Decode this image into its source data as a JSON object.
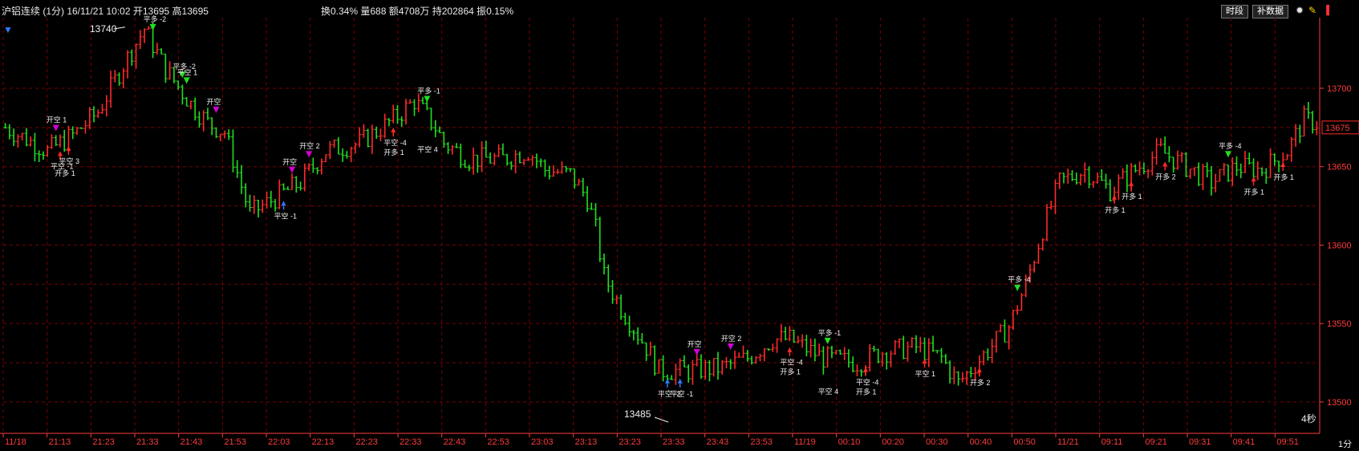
{
  "header": {
    "title": "沪铝连续 (1分) 16/11/21 10:02 开13695  高13695",
    "stats": "换0.34% 量688 额4708万 持202864 振0.15%",
    "timeshare_label": "时段",
    "fill_data_label": "补数据",
    "icons": [
      "settings-icon",
      "paint-icon",
      "sidebar-icon"
    ]
  },
  "footer": {
    "speed": "4秒",
    "period": "1分"
  },
  "colors": {
    "up": "#ff2a2a",
    "down": "#20e020",
    "grid": "#7a0000",
    "axis": "#ff3b3b",
    "current_price_box": "#ff2a2a"
  },
  "chart_data": {
    "type": "bar",
    "title": "",
    "y_range": [
      13480,
      13745
    ],
    "y_ticks": [
      13500,
      13550,
      13600,
      13650,
      13700
    ],
    "x_ticks": [
      "11/18",
      "21:13",
      "21:23",
      "21:33",
      "21:43",
      "21:53",
      "22:03",
      "22:13",
      "22:23",
      "22:33",
      "22:43",
      "22:53",
      "23:03",
      "23:13",
      "23:23",
      "23:33",
      "23:43",
      "23:53",
      "11/19",
      "00:10",
      "00:20",
      "00:30",
      "00:40",
      "00:50",
      "11/21",
      "09:11",
      "09:21",
      "09:31",
      "09:41",
      "09:51"
    ],
    "current_price": 13675,
    "high_label": {
      "price": 13740,
      "text": "13740"
    },
    "low_label": {
      "price": 13485,
      "text": "13485"
    },
    "close_path": [
      [
        0,
        13675
      ],
      [
        10,
        13660
      ],
      [
        16,
        13670
      ],
      [
        22,
        13685
      ],
      [
        28,
        13715
      ],
      [
        33,
        13738
      ],
      [
        38,
        13712
      ],
      [
        44,
        13690
      ],
      [
        48,
        13678
      ],
      [
        52,
        13672
      ],
      [
        54,
        13655
      ],
      [
        58,
        13620
      ],
      [
        64,
        13630
      ],
      [
        70,
        13640
      ],
      [
        76,
        13660
      ],
      [
        84,
        13665
      ],
      [
        92,
        13680
      ],
      [
        97,
        13692
      ],
      [
        102,
        13675
      ],
      [
        104,
        13665
      ],
      [
        110,
        13655
      ],
      [
        118,
        13655
      ],
      [
        124,
        13660
      ],
      [
        128,
        13648
      ],
      [
        134,
        13645
      ],
      [
        138,
        13630
      ],
      [
        140,
        13610
      ],
      [
        142,
        13580
      ],
      [
        146,
        13560
      ],
      [
        152,
        13535
      ],
      [
        155,
        13520
      ],
      [
        162,
        13520
      ],
      [
        170,
        13522
      ],
      [
        176,
        13528
      ],
      [
        182,
        13540
      ],
      [
        186,
        13540
      ],
      [
        194,
        13528
      ],
      [
        202,
        13525
      ],
      [
        208,
        13532
      ],
      [
        216,
        13535
      ],
      [
        222,
        13528
      ],
      [
        226,
        13512
      ],
      [
        232,
        13530
      ],
      [
        238,
        13548
      ],
      [
        242,
        13575
      ],
      [
        246,
        13610
      ],
      [
        250,
        13640
      ],
      [
        256,
        13648
      ],
      [
        262,
        13635
      ],
      [
        268,
        13648
      ],
      [
        274,
        13660
      ],
      [
        280,
        13650
      ],
      [
        286,
        13640
      ],
      [
        292,
        13650
      ],
      [
        298,
        13648
      ],
      [
        304,
        13660
      ],
      [
        308,
        13680
      ],
      [
        311,
        13678
      ]
    ],
    "signals": [
      {
        "bar": 12,
        "label": "开空 1",
        "type": "down",
        "color": "#d600d6"
      },
      {
        "bar": 13,
        "label": "平空 -1",
        "type": "up",
        "color": "#ff2a2a"
      },
      {
        "bar": 15,
        "label": "平空 3",
        "type": "up",
        "color": "#ff2a2a"
      },
      {
        "bar": 14,
        "label": "开多 1",
        "type": "none",
        "color": "#ff2a2a"
      },
      {
        "bar": 35,
        "label": "平多 -2",
        "type": "down",
        "color": "#20e020"
      },
      {
        "bar": 42,
        "label": "平多 -2",
        "type": "down",
        "color": "#20e020"
      },
      {
        "bar": 43,
        "label": "平空 1",
        "type": "down",
        "color": "#20e020"
      },
      {
        "bar": 50,
        "label": "开空",
        "type": "down",
        "color": "#d600d6"
      },
      {
        "bar": 66,
        "label": "平空 -1",
        "type": "up",
        "color": "#2e7cff"
      },
      {
        "bar": 68,
        "label": "开空",
        "type": "down",
        "color": "#d600d6"
      },
      {
        "bar": 72,
        "label": "开空 2",
        "type": "down",
        "color": "#d600d6"
      },
      {
        "bar": 92,
        "label": "平空 -4",
        "type": "up",
        "color": "#ff2a2a"
      },
      {
        "bar": 92,
        "label": "开多 1",
        "type": "none",
        "color": "#ff2a2a"
      },
      {
        "bar": 100,
        "label": "平多 -1",
        "type": "down",
        "color": "#20e020"
      },
      {
        "bar": 100,
        "label": "平空 4",
        "type": "none",
        "color": "#20e020"
      },
      {
        "bar": 157,
        "label": "平空 -2",
        "type": "up",
        "color": "#2e7cff"
      },
      {
        "bar": 160,
        "label": "平空 -1",
        "type": "up",
        "color": "#2e7cff"
      },
      {
        "bar": 164,
        "label": "开空",
        "type": "down",
        "color": "#d600d6"
      },
      {
        "bar": 172,
        "label": "开空 2",
        "type": "down",
        "color": "#d600d6"
      },
      {
        "bar": 186,
        "label": "平空 -4",
        "type": "up",
        "color": "#ff2a2a"
      },
      {
        "bar": 186,
        "label": "开多 1",
        "type": "none",
        "color": "#ff2a2a"
      },
      {
        "bar": 195,
        "label": "平多 -1",
        "type": "down",
        "color": "#20e020"
      },
      {
        "bar": 195,
        "label": "平空 4",
        "type": "none",
        "color": "#20e020"
      },
      {
        "bar": 204,
        "label": "平空 -4",
        "type": "up",
        "color": "#ff2a2a"
      },
      {
        "bar": 204,
        "label": "开多 1",
        "type": "none",
        "color": "#ff2a2a"
      },
      {
        "bar": 218,
        "label": "平空 1",
        "type": "up",
        "color": "#ff2a2a"
      },
      {
        "bar": 231,
        "label": "开多 2",
        "type": "up",
        "color": "#ff2a2a"
      },
      {
        "bar": 240,
        "label": "平多 -4",
        "type": "down",
        "color": "#20e020"
      },
      {
        "bar": 263,
        "label": "开多 1",
        "type": "up",
        "color": "#ff2a2a"
      },
      {
        "bar": 267,
        "label": "开多 1",
        "type": "up",
        "color": "#ff2a2a"
      },
      {
        "bar": 275,
        "label": "开多 2",
        "type": "up",
        "color": "#ff2a2a"
      },
      {
        "bar": 290,
        "label": "平多 -4",
        "type": "down",
        "color": "#20e020"
      },
      {
        "bar": 296,
        "label": "开多 1",
        "type": "up",
        "color": "#ff2a2a"
      },
      {
        "bar": 303,
        "label": "开多 1",
        "type": "up",
        "color": "#ff2a2a"
      }
    ]
  }
}
